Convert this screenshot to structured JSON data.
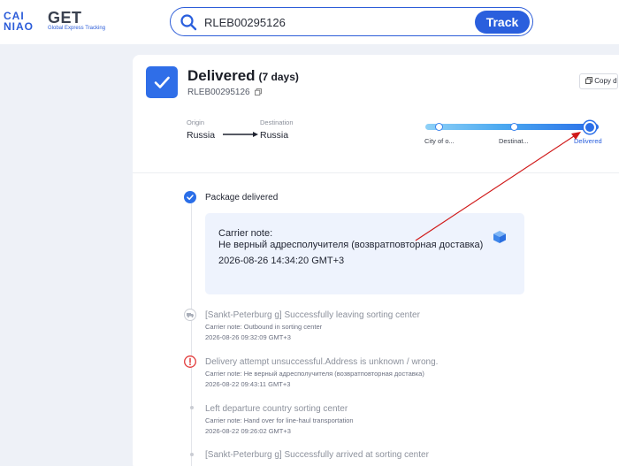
{
  "header": {
    "logo_mark_line1": "CAI",
    "logo_mark_line2": "NIAO",
    "logo_get": "GET",
    "logo_sub": "Global Express Tracking"
  },
  "search": {
    "value": "RLEB00295126",
    "placeholder": "",
    "track_label": "Track"
  },
  "shipment": {
    "status": "Delivered",
    "days": "(7 days)",
    "tracking_number": "RLEB00295126",
    "copy_label": "Copy d",
    "origin_label": "Origin",
    "origin_value": "Russia",
    "destination_label": "Destination",
    "destination_value": "Russia"
  },
  "progress": {
    "stages": [
      "City of o...",
      "Destinat...",
      "Delivered"
    ],
    "active_index": 2
  },
  "events": [
    {
      "title": "Package delivered",
      "note_label": "Carrier note:",
      "note": "Не верный адресполучителя (возвратповторная доставка)",
      "time": "2026-08-26 14:34:20 GMT+3",
      "icon": "check-circle-icon"
    },
    {
      "title": "[Sankt-Peterburg g] Successfully leaving sorting center",
      "note": "Carrier note: Outbound in sorting center",
      "time": "2026-08-26 09:32:09 GMT+3",
      "icon": "truck-icon"
    },
    {
      "title": "Delivery attempt unsuccessful.Address is unknown / wrong.",
      "note": "Carrier note: Не верный адресполучителя (возвратповторная доставка)",
      "time": "2026-08-22 09:43:11 GMT+3",
      "icon": "alert-circle-icon"
    },
    {
      "title": "Left departure country sorting center",
      "note": "Carrier note: Hand over for line-haul transportation",
      "time": "2026-08-22 09:26:02 GMT+3",
      "icon": "dot-icon"
    },
    {
      "title": "[Sankt-Peterburg g] Successfully arrived at sorting center",
      "icon": "dot-icon"
    }
  ],
  "colors": {
    "accent": "#2a5fdd",
    "alert": "#e23b3b",
    "annotation_arrow": "#d01818"
  }
}
